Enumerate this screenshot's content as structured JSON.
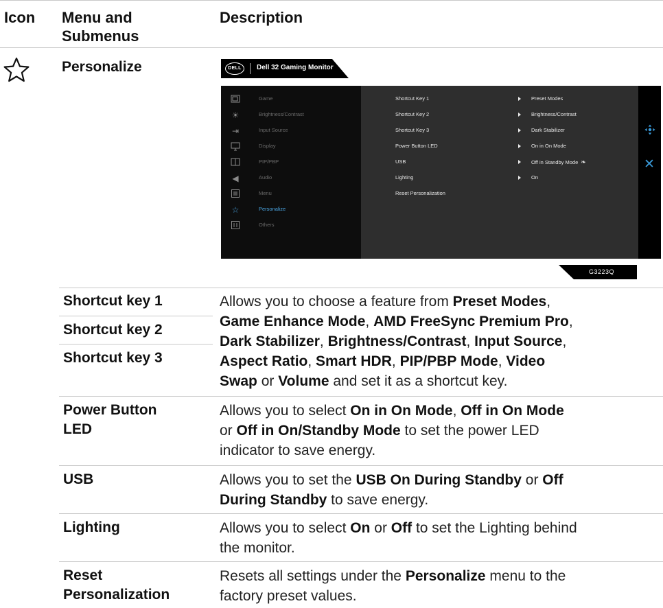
{
  "header": {
    "col_icon": "Icon",
    "col_menu_line1": "Menu and",
    "col_menu_line2": "Submenus",
    "col_desc": "Description"
  },
  "section": {
    "icon": "star-icon",
    "title": "Personalize"
  },
  "osd": {
    "brand_logo": "DELL",
    "title": "Dell 32 Gaming Monitor",
    "menu": [
      {
        "label": "Game",
        "icon": "game-icon"
      },
      {
        "label": "Brightness/Contrast",
        "icon": "brightness-icon"
      },
      {
        "label": "Input Source",
        "icon": "input-source-icon"
      },
      {
        "label": "Display",
        "icon": "display-icon"
      },
      {
        "label": "PIP/PBP",
        "icon": "pip-icon"
      },
      {
        "label": "Audio",
        "icon": "audio-icon"
      },
      {
        "label": "Menu",
        "icon": "menu-icon"
      },
      {
        "label": "Personalize",
        "icon": "star-icon",
        "active": true
      },
      {
        "label": "Others",
        "icon": "others-icon"
      }
    ],
    "submenu": [
      {
        "label": "Shortcut Key 1",
        "value": "Preset Modes"
      },
      {
        "label": "Shortcut Key 2",
        "value": "Brightness/Contrast"
      },
      {
        "label": "Shortcut Key 3",
        "value": "Dark Stabilizer"
      },
      {
        "label": "Power Button LED",
        "value": "On in On Mode"
      },
      {
        "label": "USB",
        "value": "Off in Standby Mode"
      },
      {
        "label": "Lighting",
        "value": "On"
      },
      {
        "label": "Reset Personalization",
        "value": ""
      }
    ],
    "model": "G3223Q",
    "accent_color": "#4aa3df"
  },
  "rows": [
    {
      "label": "Shortcut key 1"
    },
    {
      "label": "Shortcut key 2"
    },
    {
      "label": "Shortcut key 3"
    },
    {
      "label_line1": "Power Button",
      "label_line2": "LED"
    },
    {
      "label": "USB"
    },
    {
      "label": "Lighting"
    },
    {
      "label_line1": "Reset",
      "label_line2": "Personalization"
    }
  ],
  "descriptions": {
    "shortcut": {
      "t1": "Allows you to choose a feature from ",
      "b1": "Preset Modes",
      "t2": ",",
      "b2": "Game Enhance Mode",
      "t3": ", ",
      "b3": "AMD FreeSync Premium Pro",
      "t4": ",",
      "b4": "Dark Stabilizer",
      "t5": ", ",
      "b5": "Brightness/Contrast",
      "t6": ", ",
      "b6": "Input Source",
      "t7": ",",
      "b7": "Aspect Ratio",
      "t8": ", ",
      "b8": "Smart HDR",
      "t9": ", ",
      "b9": "PIP/PBP Mode",
      "t10": ", ",
      "b10": "Video",
      "b11": "Swap",
      "t11": " or ",
      "b12": "Volume",
      "t12": " and set it as a shortcut key."
    },
    "power_led": {
      "t1": "Allows you to select ",
      "b1": "On in On Mode",
      "t2": ", ",
      "b2": "Off in On Mode",
      "t3": "or ",
      "b3": "Off in On/Standby Mode",
      "t4": " to set the power LED",
      "t5": "indicator to save energy."
    },
    "usb": {
      "t1": "Allows you to set the ",
      "b1": "USB On During Standby",
      "t2": " or ",
      "b2": "Off",
      "b3": "During Standby",
      "t3": " to save energy."
    },
    "lighting": {
      "t1": "Allows you to select ",
      "b1": "On",
      "t2": " or ",
      "b2": "Off",
      "t3": " to set the Lighting behind",
      "t4": "the monitor."
    },
    "reset": {
      "t1": "Resets all settings under the ",
      "b1": "Personalize",
      "t2": " menu to the",
      "t3": "factory preset values."
    }
  }
}
